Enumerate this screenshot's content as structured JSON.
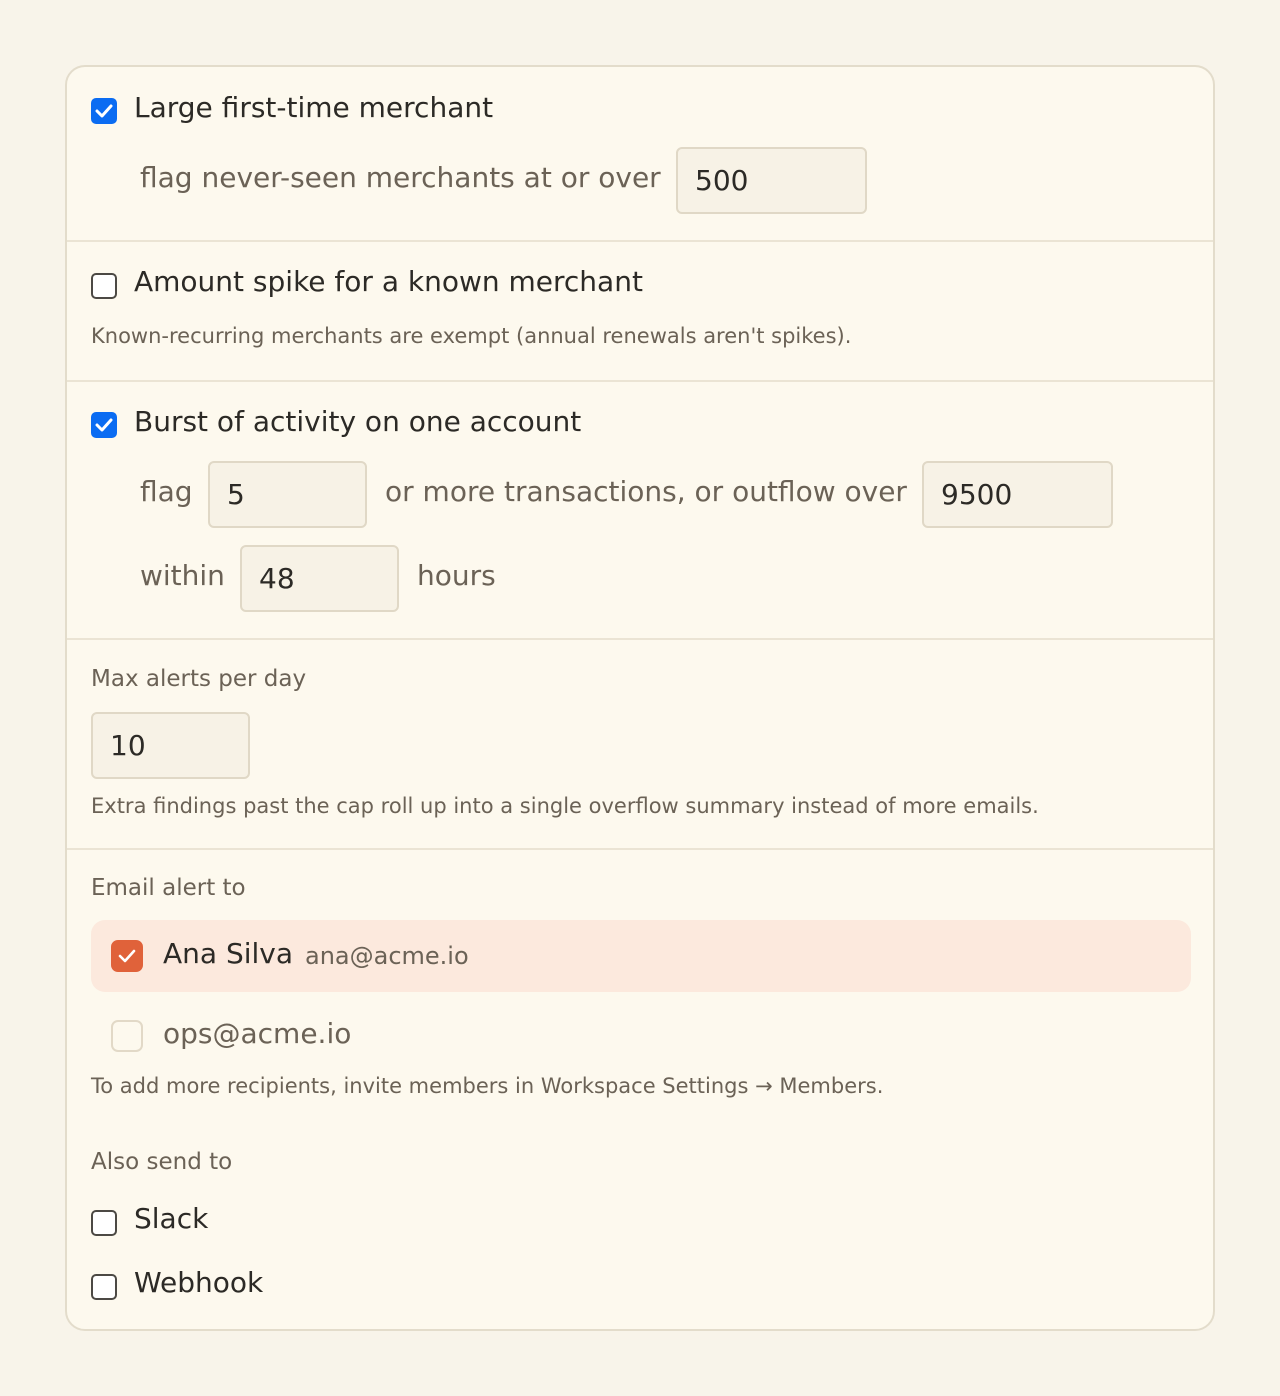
{
  "rules": {
    "large_merchant": {
      "checked": true,
      "title": "Large first-time merchant",
      "prefix": "flag never-seen merchants at or over",
      "threshold": "500"
    },
    "amount_spike": {
      "checked": false,
      "title": "Amount spike for a known merchant",
      "help": "Known-recurring merchants are exempt (annual renewals aren't spikes)."
    },
    "burst": {
      "checked": true,
      "title": "Burst of activity on one account",
      "flag_label": "flag",
      "count": "5",
      "middle_label": "or more transactions, or outflow over",
      "outflow": "9500",
      "within_label": "within",
      "hours": "48",
      "hours_label": "hours"
    }
  },
  "max_alerts": {
    "label": "Max alerts per day",
    "value": "10",
    "help": "Extra findings past the cap roll up into a single overflow summary instead of more emails."
  },
  "email": {
    "label": "Email alert to",
    "recipients": [
      {
        "name": "Ana Silva",
        "email": "ana@acme.io",
        "checked": true
      },
      {
        "name": "",
        "email": "ops@acme.io",
        "checked": false
      }
    ],
    "help": "To add more recipients, invite members in Workspace Settings → Members."
  },
  "also_send": {
    "label": "Also send to",
    "options": [
      {
        "label": "Slack",
        "checked": false
      },
      {
        "label": "Webhook",
        "checked": false
      }
    ]
  },
  "colors": {
    "page_bg": "#f8f4ea",
    "card_bg": "#fdf9ee",
    "checkbox_blue": "#0b6cf2",
    "accent_orange": "#e0623a",
    "selected_row": "#fce9dd"
  }
}
